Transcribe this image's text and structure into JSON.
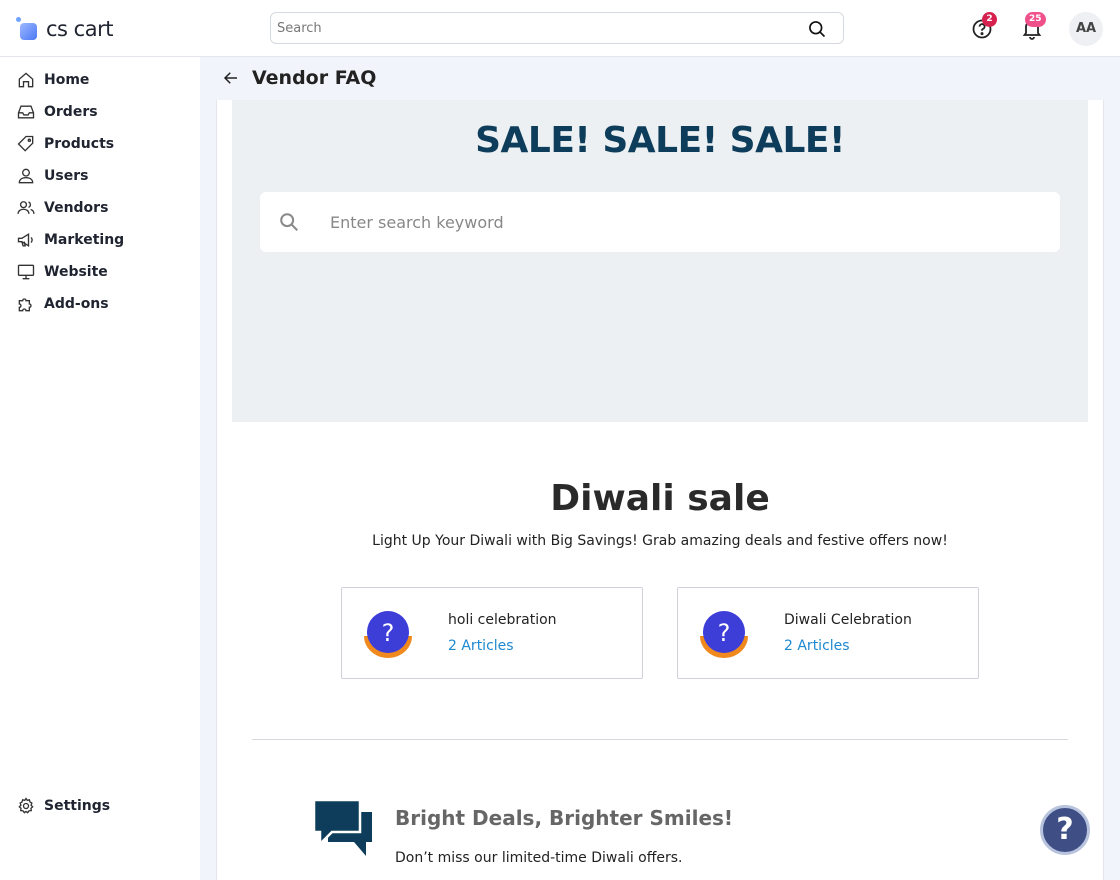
{
  "header": {
    "logo_text": "cs cart",
    "search_placeholder": "Search",
    "help_badge": "2",
    "notifications_badge": "25",
    "avatar_initials": "AA"
  },
  "sidebar": {
    "items": [
      {
        "label": "Home"
      },
      {
        "label": "Orders"
      },
      {
        "label": "Products"
      },
      {
        "label": "Users"
      },
      {
        "label": "Vendors"
      },
      {
        "label": "Marketing"
      },
      {
        "label": "Website"
      },
      {
        "label": "Add-ons"
      }
    ],
    "settings_label": "Settings"
  },
  "page": {
    "title": "Vendor FAQ"
  },
  "hero": {
    "title": "SALE! SALE! SALE!",
    "search_placeholder": "Enter search keyword"
  },
  "section": {
    "title": "Diwali sale",
    "subtitle": "Light Up Your Diwali with Big Savings! Grab amazing deals and festive offers now!",
    "categories": [
      {
        "name": "holi celebration",
        "count": "2 Articles"
      },
      {
        "name": "Diwali Celebration",
        "count": "2 Articles"
      }
    ]
  },
  "promo": {
    "title": "Bright Deals, Brighter Smiles!",
    "subtitle": "Don’t miss our limited-time Diwali offers."
  },
  "help_fab": {
    "label": "?"
  },
  "colors": {
    "hero_title": "#0d3d5a",
    "link": "#1e88d1",
    "badge": "#d6204e",
    "badge_alt": "#f0508a",
    "fab": "#3f4f86",
    "category_icon_blue": "#3d3dd8",
    "category_icon_orange": "#f08a1e"
  }
}
